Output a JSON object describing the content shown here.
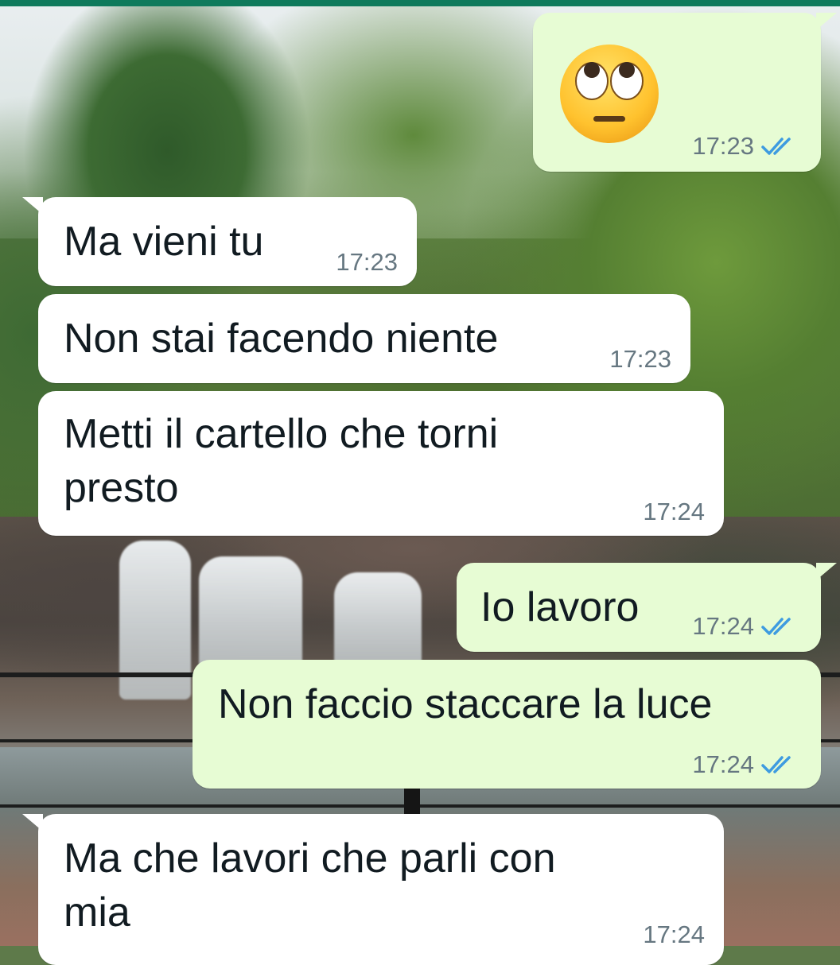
{
  "theme": {
    "incoming_bubble": "#ffffff",
    "outgoing_bubble": "#e7fcd4",
    "timestamp_color": "#667781",
    "read_check_color": "#3e9be0",
    "header_accent": "#0f7a5c"
  },
  "chat": {
    "messages": [
      {
        "direction": "outgoing",
        "emoji": "face-with-rolling-eyes",
        "time": "17:23",
        "status": "read"
      },
      {
        "direction": "incoming",
        "text": "Ma vieni tu",
        "time": "17:23"
      },
      {
        "direction": "incoming",
        "text": "Non stai facendo niente",
        "time": "17:23"
      },
      {
        "direction": "incoming",
        "text": "Metti il cartello che torni\npresto",
        "time": "17:24"
      },
      {
        "direction": "outgoing",
        "text": "Io lavoro",
        "time": "17:24",
        "status": "read"
      },
      {
        "direction": "outgoing",
        "text": "Non faccio staccare la luce",
        "time": "17:24",
        "status": "read"
      },
      {
        "direction": "incoming",
        "text": "Ma che lavori che parli con\nmia",
        "time": "17:24"
      }
    ]
  }
}
